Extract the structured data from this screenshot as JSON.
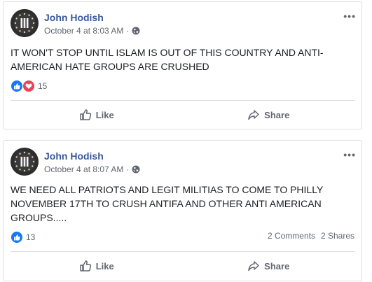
{
  "posts": [
    {
      "author": "John Hodish",
      "timestamp": "October 4 at 8:03 AM",
      "separator": "·",
      "privacy_icon": "globe-icon",
      "more": "•••",
      "text": "IT WON'T STOP UNTIL ISLAM IS OUT OF THIS COUNTRY AND ANTI-AMERICAN HATE GROUPS ARE CRUSHED",
      "reactions": [
        "like",
        "love"
      ],
      "reaction_count": "15",
      "comments": "",
      "shares": "",
      "actions": {
        "like": "Like",
        "share": "Share"
      }
    },
    {
      "author": "John Hodish",
      "timestamp": "October 4 at 8:07 AM",
      "separator": "·",
      "privacy_icon": "globe-icon",
      "more": "•••",
      "text": "WE NEED ALL PATRIOTS AND LEGIT MILITIAS TO COME TO PHILLY NOVEMBER 17TH TO CRUSH ANTIFA AND OTHER ANTI AMERICAN GROUPS.....",
      "reactions": [
        "like"
      ],
      "reaction_count": "13",
      "comments": "2 Comments",
      "shares": "2 Shares",
      "actions": {
        "like": "Like",
        "share": "Share"
      }
    }
  ],
  "colors": {
    "author": "#385898",
    "meta": "#616770",
    "like": "#1877f2",
    "love": "#f33e58",
    "divider": "#dadde1"
  }
}
